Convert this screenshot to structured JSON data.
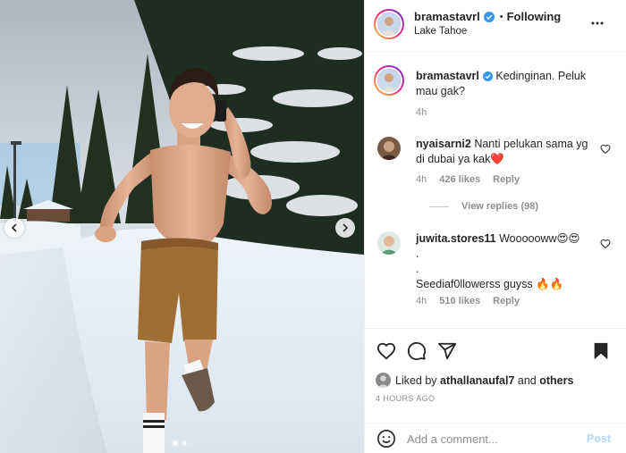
{
  "post": {
    "author": "bramastavrl",
    "follow_status": "Following",
    "bullet": "•",
    "location": "Lake Tahoe",
    "caption": "Kedinginan. Peluk mau gak?",
    "caption_age": "4h"
  },
  "comments": [
    {
      "username": "nyaisarni2",
      "text": "Nanti pelukan sama yg di dubai ya kak❤️",
      "age": "4h",
      "likes": "426 likes",
      "reply_label": "Reply",
      "view_replies": "View replies (98)"
    },
    {
      "username": "juwita.stores11",
      "text": "Woooooww😍😍",
      "line2": ".",
      "line3": ".",
      "line4": "Seediaf0llowerss guyss 🔥🔥",
      "age": "4h",
      "likes": "510 likes",
      "reply_label": "Reply"
    }
  ],
  "likes": {
    "prefix": "Liked by",
    "user": "athallanaufal7",
    "and": "and",
    "others": "others"
  },
  "timestamp": "4 HOURS AGO",
  "composer": {
    "placeholder": "Add a comment...",
    "post_label": "Post"
  },
  "carousel": {
    "total": 2,
    "active_index": 0
  },
  "colors": {
    "verified_blue": "#3897f0",
    "post_button_disabled": "#b3dbff",
    "secondary_text": "#8e8e8e"
  },
  "icons": {
    "more": "more-options-icon",
    "like": "heart-icon",
    "comment": "comment-icon",
    "share": "share-icon",
    "save": "bookmark-icon",
    "emoji": "emoji-icon",
    "prev": "chevron-left-icon",
    "next": "chevron-right-icon"
  }
}
